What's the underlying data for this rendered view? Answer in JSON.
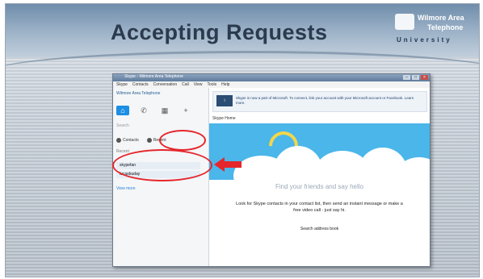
{
  "slide": {
    "title": "Accepting Requests",
    "logo": {
      "line1": "Wilmore Area",
      "line2": "Telephone",
      "line3": "University"
    }
  },
  "window": {
    "title": "Skype - Wilmore Area Telephone",
    "menu": [
      "Skype",
      "Contacts",
      "Conversation",
      "Call",
      "View",
      "Tools",
      "Help"
    ],
    "sidebar": {
      "profile_name": "Wilmore Area Telephone",
      "search_placeholder": "Search",
      "contacts_label": "Contacts",
      "recent_label": "Recent",
      "recent_section": "Recent",
      "requests": [
        "skypefan",
        "lucasbuday"
      ],
      "more_link": "View more"
    },
    "main": {
      "notice": "Skype is now a part of Microsoft. To connect, link your account with your Microsoft account or Facebook. Learn more.",
      "header": "Skype Home",
      "find_title": "Find your friends and say hello",
      "description": "Look for Skype contacts in your contact list, then send an instant message or make a free video call - just say hi.",
      "link_button": "Search address book"
    }
  },
  "colors": {
    "highlight": "#e5262b",
    "skype_blue": "#4ab6ea",
    "title_text": "#2b3a4d"
  }
}
